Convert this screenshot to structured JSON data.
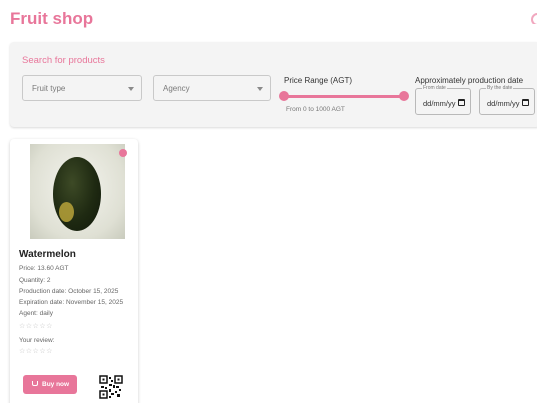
{
  "header": {
    "title": "Fruit shop"
  },
  "filters": {
    "title": "Search for products",
    "fruit_type": {
      "placeholder": "Fruit type"
    },
    "agency": {
      "placeholder": "Agency"
    },
    "price": {
      "label": "Price Range (AGT)",
      "range_text": "From 0 to 1000 AGT",
      "min": 0,
      "max": 1000
    },
    "dates": {
      "label": "Approximately production date",
      "from_label": "From date",
      "to_label": "By the date",
      "from_value": "dd/mm/yy",
      "to_value": "dd/mm/yy"
    }
  },
  "product": {
    "name": "Watermelon",
    "price": "Price: 13.60 AGT",
    "quantity": "Quantity: 2",
    "production_date": "Production date: October 15, 2025",
    "expiration_date": "Expiration date: November 15, 2025",
    "agent": "Agent: daily",
    "rating_stars": "☆☆☆☆☆",
    "your_review_label": "Your review:",
    "review_stars": "☆☆☆☆☆",
    "buy_label": "Buy now"
  },
  "colors": {
    "accent": "#e8769a",
    "panel": "#f4f4f4"
  },
  "icons": {
    "calendar": "calendar-icon",
    "cart": "cart-icon",
    "qr": "qr-code-icon"
  }
}
